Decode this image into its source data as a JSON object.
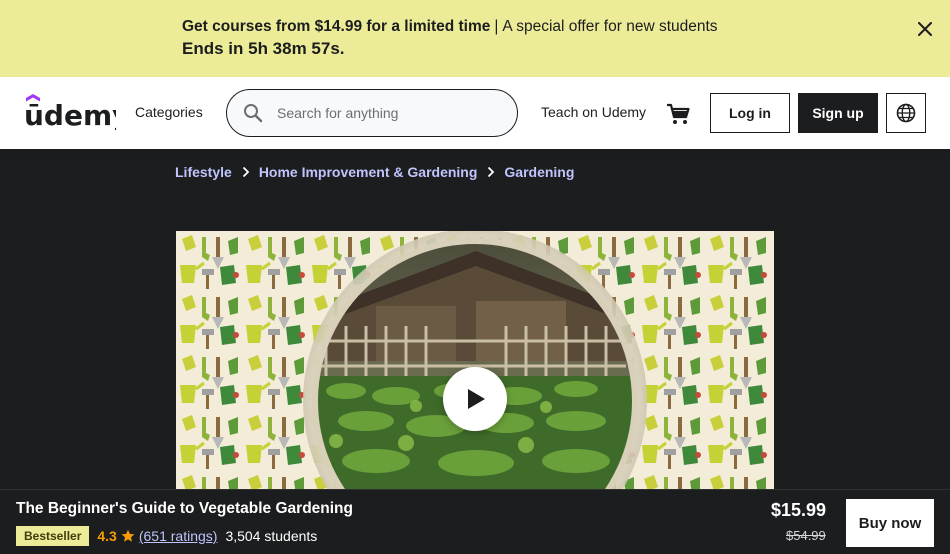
{
  "promo": {
    "headline": "Get courses from $14.99 for a limited time",
    "separator": "|",
    "subtext": "A special offer for new students",
    "countdown": "Ends in 5h 38m 57s."
  },
  "header": {
    "logo": "ūdemy",
    "categories": "Categories",
    "search_placeholder": "Search for anything",
    "teach": "Teach on Udemy",
    "login": "Log in",
    "signup": "Sign up"
  },
  "breadcrumb": [
    "Lifestyle",
    "Home Improvement & Gardening",
    "Gardening"
  ],
  "course": {
    "title": "The Beginner's Guide to Vegetable Gardening",
    "badge": "Bestseller",
    "rating": "4.3",
    "ratings_count": "(651 ratings)",
    "students": "3,504 students",
    "price": "$15.99",
    "original_price": "$54.99",
    "buy_label": "Buy now"
  },
  "icons": {
    "close": "close-icon",
    "search": "search-icon",
    "cart": "cart-icon",
    "language": "globe-icon",
    "chevron": "chevron-right-icon",
    "play": "play-icon",
    "star": "star-icon"
  },
  "colors": {
    "promo_bg": "#eceb98",
    "dark_bg": "#1c1d1f",
    "link": "#c0c4fc",
    "rating": "#f69c08",
    "logo_accent": "#a435f0"
  }
}
